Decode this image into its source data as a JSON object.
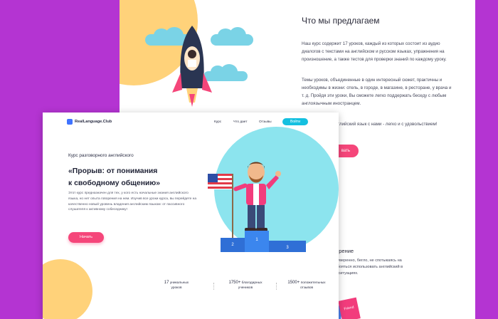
{
  "colors": {
    "background": "#b434d2",
    "accent_pink": "#f5467a",
    "accent_teal": "#8ce4ee",
    "accent_yellow": "#ffd27a",
    "login_blue": "#14c0e0"
  },
  "back_page": {
    "title": "Что мы предлагаем",
    "paragraph1": "Наш курс содержит 17 уроков, каждый из которых состоит из аудио диалогов с текстами на английском и русском языках, упражнения на произношение, а также тестов для проверки знаний по каждому уроку.",
    "paragraph2": "Темы уроков, объединенные в один интересный сюжет, практичны и необходимы в жизни: отель, в городе, в магазине, в ресторане, у врача и т. д. Пройдя эти уроки, Вы сможете легко поддержать беседу с любым англоязычным иностранцем.",
    "paragraph3": "английский язык с нами - легко и с удовольствием!",
    "button_label": "вать",
    "section_title": "оворение",
    "section_text": "ься уверенно, бегло, не спотыкаясь на\nьте бояться использовать английский в\nных ситуациях.",
    "card_pink_text": "Friend",
    "card_blue_text": "craft"
  },
  "front_page": {
    "logo_text": "RealLanguage.Club",
    "nav": {
      "course": "Курс",
      "what_gives": "Что дает",
      "reviews": "Отзывы",
      "login": "Войти"
    },
    "subtitle": "Курс разговорного английского",
    "headline_line1": "«Прорыв: от понимания",
    "headline_line2": "к свободному общению»",
    "description": "Этот курс предназначен для тех, у кого есть начальные знания английского языка, но нет опыта говорения на нем. Изучив все уроки курса, вы перейдете на качественно новый уровень владения английским языком: от пассивного слушателя к активному собеседнику!",
    "start_button": "Начать",
    "podium": {
      "first": "1",
      "second": "2",
      "third": "3"
    },
    "stats": [
      {
        "value": "17",
        "label_line1": "уникальных",
        "label_line2": "уроков"
      },
      {
        "value": "1750+",
        "label_line1": "благодарных",
        "label_line2": "учеников"
      },
      {
        "value": "1500+",
        "label_line1": "положительных",
        "label_line2": "отзывов"
      }
    ]
  }
}
